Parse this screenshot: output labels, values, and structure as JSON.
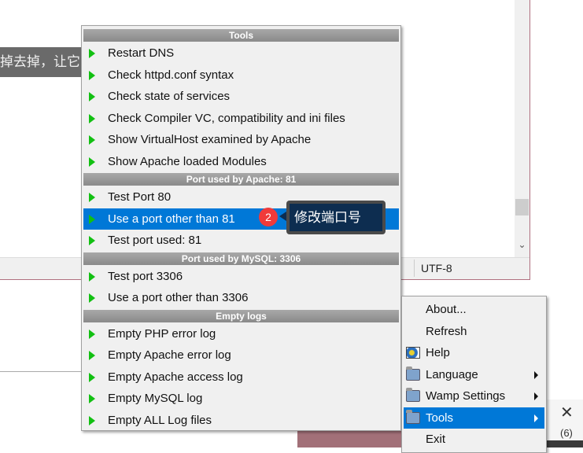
{
  "background": {
    "chinese_text": "掉去掉，让它",
    "encoding": "UTF-8"
  },
  "tools_menu": {
    "sections": [
      {
        "header": "Tools",
        "items": [
          "Restart DNS",
          "Check httpd.conf syntax",
          "Check state of services",
          "Check Compiler VC, compatibility and ini files",
          "Show VirtualHost examined by Apache",
          "Show Apache loaded Modules"
        ]
      },
      {
        "header": "Port used by Apache: 81",
        "items": [
          "Test Port 80",
          "Use a port other than 81",
          "Test port used: 81"
        ]
      },
      {
        "header": "Port used by MySQL: 3306",
        "items": [
          "Test port 3306",
          "Use a port other than 3306"
        ]
      },
      {
        "header": "Empty logs",
        "items": [
          "Empty PHP error log",
          "Empty Apache error log",
          "Empty Apache access log",
          "Empty MySQL log",
          "Empty ALL Log files"
        ]
      }
    ],
    "selected": "Use a port other than 81"
  },
  "annotation": {
    "badge": "2",
    "tooltip": "修改端口号"
  },
  "main_menu": {
    "items": [
      {
        "label": "About...",
        "icon": ""
      },
      {
        "label": "Refresh",
        "icon": ""
      },
      {
        "label": "Help",
        "icon": "help-icon"
      },
      {
        "label": "Language",
        "icon": "folder-icon",
        "submenu": true
      },
      {
        "label": "Wamp Settings",
        "icon": "folder-icon",
        "submenu": true
      },
      {
        "label": "Tools",
        "icon": "folder-icon",
        "submenu": true,
        "selected": true
      },
      {
        "label": "Exit",
        "icon": ""
      }
    ]
  },
  "notification": {
    "close": "✕",
    "count": "(6)"
  },
  "colors": {
    "highlight": "#0078d7",
    "arrow": "#12c012",
    "badge": "#f03a3a"
  }
}
